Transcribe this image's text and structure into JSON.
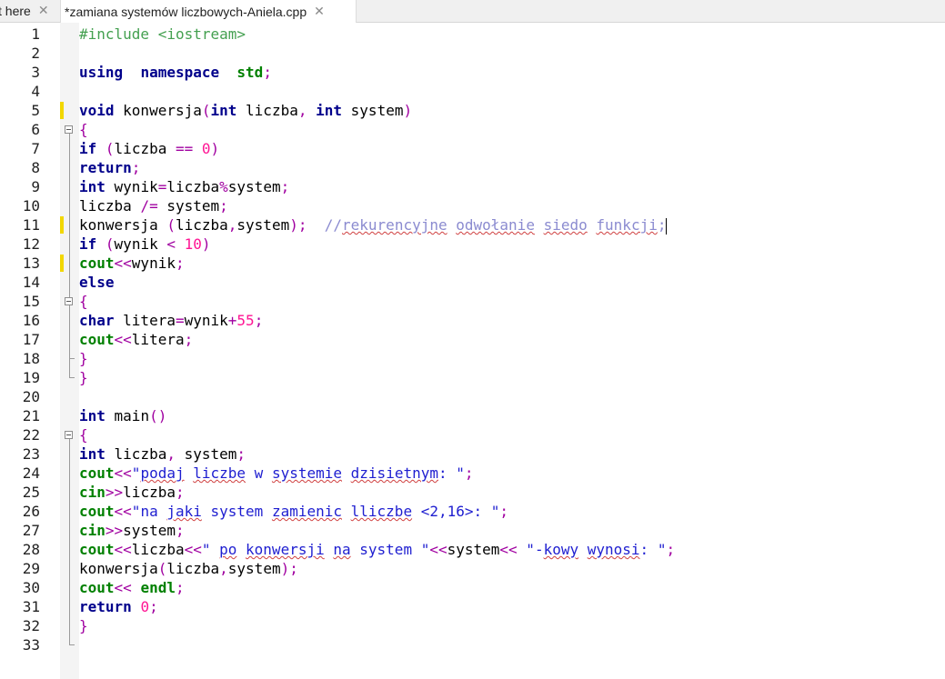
{
  "tabs": [
    {
      "label": "t here",
      "close": "✕"
    },
    {
      "label": "*zamiana systemów liczbowych-Aniela.cpp",
      "close": "✕"
    }
  ],
  "line_numbers": [
    "1",
    "2",
    "3",
    "4",
    "5",
    "6",
    "7",
    "8",
    "9",
    "10",
    "11",
    "12",
    "13",
    "14",
    "15",
    "16",
    "17",
    "18",
    "19",
    "20",
    "21",
    "22",
    "23",
    "24",
    "25",
    "26",
    "27",
    "28",
    "29",
    "30",
    "31",
    "32",
    "33"
  ],
  "code": [
    [
      [
        "pp",
        "#include <iostream>"
      ]
    ],
    [],
    [
      [
        "kw",
        "using"
      ],
      [
        "",
        "  "
      ],
      [
        "kw",
        "namespace"
      ],
      [
        "",
        "  "
      ],
      [
        "io",
        "std"
      ],
      [
        "op",
        ";"
      ]
    ],
    [],
    [
      [
        "kw",
        "void"
      ],
      [
        "",
        " konwersja"
      ],
      [
        "op",
        "("
      ],
      [
        "kw",
        "int"
      ],
      [
        "",
        " liczba"
      ],
      [
        "op",
        ","
      ],
      [
        "",
        " "
      ],
      [
        "kw",
        "int"
      ],
      [
        "",
        " system"
      ],
      [
        "op",
        ")"
      ]
    ],
    [
      [
        "op",
        "{"
      ]
    ],
    [
      [
        "kw",
        "if"
      ],
      [
        "",
        " "
      ],
      [
        "op",
        "("
      ],
      [
        "",
        "liczba "
      ],
      [
        "op",
        "=="
      ],
      [
        "",
        " "
      ],
      [
        "num",
        "0"
      ],
      [
        "op",
        ")"
      ]
    ],
    [
      [
        "kw",
        "return"
      ],
      [
        "op",
        ";"
      ]
    ],
    [
      [
        "kw",
        "int"
      ],
      [
        "",
        " wynik"
      ],
      [
        "op",
        "="
      ],
      [
        "",
        "liczba"
      ],
      [
        "op",
        "%"
      ],
      [
        "",
        "system"
      ],
      [
        "op",
        ";"
      ]
    ],
    [
      [
        "",
        "liczba "
      ],
      [
        "op",
        "/="
      ],
      [
        "",
        " system"
      ],
      [
        "op",
        ";"
      ]
    ],
    [
      [
        "",
        "konwersja "
      ],
      [
        "op",
        "("
      ],
      [
        "",
        "liczba"
      ],
      [
        "op",
        ","
      ],
      [
        "",
        "system"
      ],
      [
        "op",
        ")"
      ],
      [
        "op",
        ";"
      ],
      [
        "",
        "  "
      ],
      [
        "cm",
        "//"
      ],
      [
        "cm sq",
        "rekurencyjne"
      ],
      [
        "cm",
        " "
      ],
      [
        "cm sq",
        "odwołanie"
      ],
      [
        "cm",
        " "
      ],
      [
        "cm sq",
        "siedo"
      ],
      [
        "cm",
        " "
      ],
      [
        "cm sq",
        "funkcji"
      ],
      [
        "cm",
        ";"
      ],
      [
        "caret",
        ""
      ]
    ],
    [
      [
        "kw",
        "if"
      ],
      [
        "",
        " "
      ],
      [
        "op",
        "("
      ],
      [
        "",
        "wynik "
      ],
      [
        "op",
        "<"
      ],
      [
        "",
        " "
      ],
      [
        "num",
        "10"
      ],
      [
        "op",
        ")"
      ]
    ],
    [
      [
        "io",
        "cout"
      ],
      [
        "op",
        "<<"
      ],
      [
        "",
        "wynik"
      ],
      [
        "op",
        ";"
      ]
    ],
    [
      [
        "kw",
        "else"
      ]
    ],
    [
      [
        "op",
        "{"
      ]
    ],
    [
      [
        "kw",
        "char"
      ],
      [
        "",
        " litera"
      ],
      [
        "op",
        "="
      ],
      [
        "",
        "wynik"
      ],
      [
        "op",
        "+"
      ],
      [
        "num",
        "55"
      ],
      [
        "op",
        ";"
      ]
    ],
    [
      [
        "io",
        "cout"
      ],
      [
        "op",
        "<<"
      ],
      [
        "",
        "litera"
      ],
      [
        "op",
        ";"
      ]
    ],
    [
      [
        "op",
        "}"
      ]
    ],
    [
      [
        "op",
        "}"
      ]
    ],
    [],
    [
      [
        "kw",
        "int"
      ],
      [
        "",
        " main"
      ],
      [
        "op",
        "()"
      ]
    ],
    [
      [
        "op",
        "{"
      ]
    ],
    [
      [
        "kw",
        "int"
      ],
      [
        "",
        " liczba"
      ],
      [
        "op",
        ","
      ],
      [
        "",
        " system"
      ],
      [
        "op",
        ";"
      ]
    ],
    [
      [
        "io",
        "cout"
      ],
      [
        "op",
        "<<"
      ],
      [
        "str",
        "\""
      ],
      [
        "str sq",
        "podaj"
      ],
      [
        "str",
        " "
      ],
      [
        "str sq",
        "liczbe"
      ],
      [
        "str",
        " w "
      ],
      [
        "str sq",
        "systemie"
      ],
      [
        "str",
        " "
      ],
      [
        "str sq",
        "dzisietnym"
      ],
      [
        "str",
        ": \""
      ],
      [
        "op",
        ";"
      ]
    ],
    [
      [
        "io",
        "cin"
      ],
      [
        "op",
        ">>"
      ],
      [
        "",
        "liczba"
      ],
      [
        "op",
        ";"
      ]
    ],
    [
      [
        "io",
        "cout"
      ],
      [
        "op",
        "<<"
      ],
      [
        "str",
        "\""
      ],
      [
        "str",
        "na "
      ],
      [
        "str sq",
        "jaki"
      ],
      [
        "str",
        " system "
      ],
      [
        "str sq",
        "zamienic"
      ],
      [
        "str",
        " "
      ],
      [
        "str sq",
        "lliczbe"
      ],
      [
        "str",
        " <2,16>: \""
      ],
      [
        "op",
        ";"
      ]
    ],
    [
      [
        "io",
        "cin"
      ],
      [
        "op",
        ">>"
      ],
      [
        "",
        "system"
      ],
      [
        "op",
        ";"
      ]
    ],
    [
      [
        "io",
        "cout"
      ],
      [
        "op",
        "<<"
      ],
      [
        "",
        "liczba"
      ],
      [
        "op",
        "<<"
      ],
      [
        "str",
        "\" "
      ],
      [
        "str sq",
        "po"
      ],
      [
        "str",
        " "
      ],
      [
        "str sq",
        "konwersji"
      ],
      [
        "str",
        " "
      ],
      [
        "str sq",
        "na"
      ],
      [
        "str",
        " system \""
      ],
      [
        "op",
        "<<"
      ],
      [
        "",
        "system"
      ],
      [
        "op",
        "<<"
      ],
      [
        "str",
        " \"-"
      ],
      [
        "str sq",
        "kowy"
      ],
      [
        "str",
        " "
      ],
      [
        "str sq",
        "wynosi"
      ],
      [
        "str",
        ": \""
      ],
      [
        "op",
        ";"
      ]
    ],
    [
      [
        "",
        "konwersja"
      ],
      [
        "op",
        "("
      ],
      [
        "",
        "liczba"
      ],
      [
        "op",
        ","
      ],
      [
        "",
        "system"
      ],
      [
        "op",
        ")"
      ],
      [
        "op",
        ";"
      ]
    ],
    [
      [
        "io",
        "cout"
      ],
      [
        "op",
        "<<"
      ],
      [
        "",
        " "
      ],
      [
        "io",
        "endl"
      ],
      [
        "op",
        ";"
      ]
    ],
    [
      [
        "kw",
        "return"
      ],
      [
        "",
        " "
      ],
      [
        "num",
        "0"
      ],
      [
        "op",
        ";"
      ]
    ],
    [
      [
        "op",
        "}"
      ]
    ],
    []
  ],
  "change_markers": [
    5,
    11,
    13
  ],
  "fold_markers": [
    6,
    15,
    22
  ]
}
